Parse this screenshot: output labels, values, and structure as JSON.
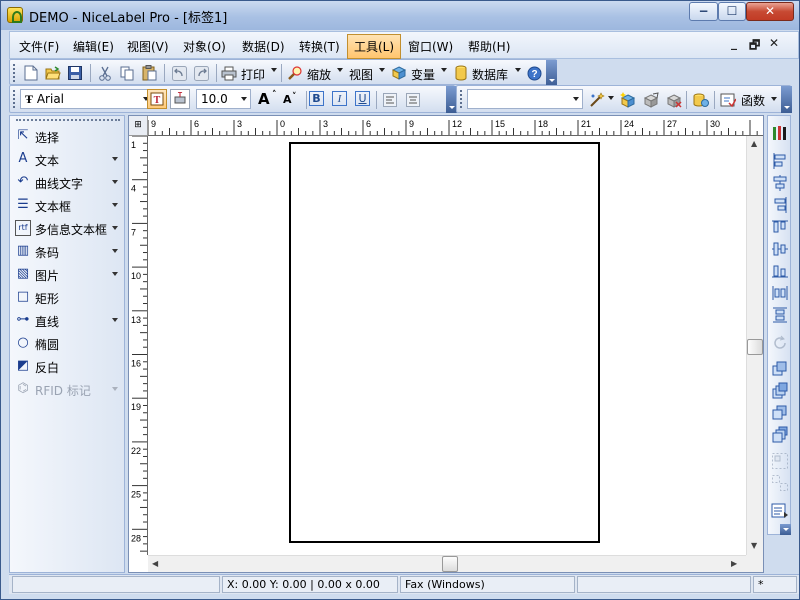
{
  "window": {
    "title": "DEMO - NiceLabel Pro - [标签1]",
    "controls": {
      "minimize": "−",
      "maximize": "☐",
      "close": "✕"
    }
  },
  "menubar": {
    "items": [
      {
        "label": "文件(F)"
      },
      {
        "label": "编辑(E)"
      },
      {
        "label": "视图(V)"
      },
      {
        "label": "对象(O)"
      },
      {
        "label": "数据(D)"
      },
      {
        "label": "转换(T)"
      },
      {
        "label": "工具(L)",
        "active": true
      },
      {
        "label": "窗口(W)"
      },
      {
        "label": "帮助(H)"
      }
    ],
    "mdi_controls": {
      "minimize": "_",
      "restore": "🗗",
      "close": "✕"
    }
  },
  "standard_toolbar": {
    "icons": [
      "new-icon",
      "open-icon",
      "save-icon",
      "cut-icon",
      "copy-icon",
      "paste-icon",
      "undo-icon",
      "redo-icon",
      "print-icon"
    ],
    "print_label": "打印",
    "zoom_label": "缩放",
    "view_label": "视图",
    "variable_label": "变量",
    "database_label": "数据库",
    "help_icon": "help-icon"
  },
  "format_toolbar": {
    "font_name": "Arial",
    "font_size": "10.0",
    "grow_label": "A",
    "shrink_label": "A",
    "bold_label": "B",
    "italic_label": "I",
    "underline_label": "U",
    "style_combo_value": "",
    "functions_label": "函数"
  },
  "palette": {
    "items": [
      {
        "label": "选择",
        "icon": "pointer-icon",
        "glyph": "⇱",
        "has_menu": false,
        "disabled": false
      },
      {
        "label": "文本",
        "icon": "text-icon",
        "glyph": "A",
        "has_menu": true,
        "disabled": false
      },
      {
        "label": "曲线文字",
        "icon": "curved-text-icon",
        "glyph": "↶",
        "has_menu": true,
        "disabled": false
      },
      {
        "label": "文本框",
        "icon": "text-box-icon",
        "glyph": "☰",
        "has_menu": true,
        "disabled": false
      },
      {
        "label": "多信息文本框",
        "icon": "rich-text-icon",
        "glyph": "rtf",
        "has_menu": true,
        "disabled": false
      },
      {
        "label": "条码",
        "icon": "barcode-icon",
        "glyph": "▥",
        "has_menu": true,
        "disabled": false
      },
      {
        "label": "图片",
        "icon": "picture-icon",
        "glyph": "▧",
        "has_menu": true,
        "disabled": false
      },
      {
        "label": "矩形",
        "icon": "rectangle-icon",
        "glyph": "□",
        "has_menu": false,
        "disabled": false
      },
      {
        "label": "直线",
        "icon": "line-icon",
        "glyph": "⊶",
        "has_menu": true,
        "disabled": false
      },
      {
        "label": "椭圆",
        "icon": "ellipse-icon",
        "glyph": "○",
        "has_menu": false,
        "disabled": false
      },
      {
        "label": "反白",
        "icon": "inverse-icon",
        "glyph": "◩",
        "has_menu": false,
        "disabled": false
      },
      {
        "label": "RFID 标记",
        "icon": "rfid-icon",
        "glyph": "⌬",
        "has_menu": true,
        "disabled": true
      }
    ]
  },
  "rulers": {
    "corner_label": "⊞",
    "h_labels": [
      "9",
      "6",
      "3",
      "0",
      "3",
      "6",
      "9",
      "12",
      "15",
      "18",
      "21",
      "24",
      "27",
      "30"
    ],
    "v_labels": [
      "1",
      "4",
      "7",
      "10",
      "13",
      "16",
      "19",
      "22",
      "25",
      "28"
    ]
  },
  "status": {
    "coords": "X:  0.00 Y:  0.00  |  0.00 x 0.00",
    "printer": "Fax (Windows)",
    "extra": "*"
  }
}
